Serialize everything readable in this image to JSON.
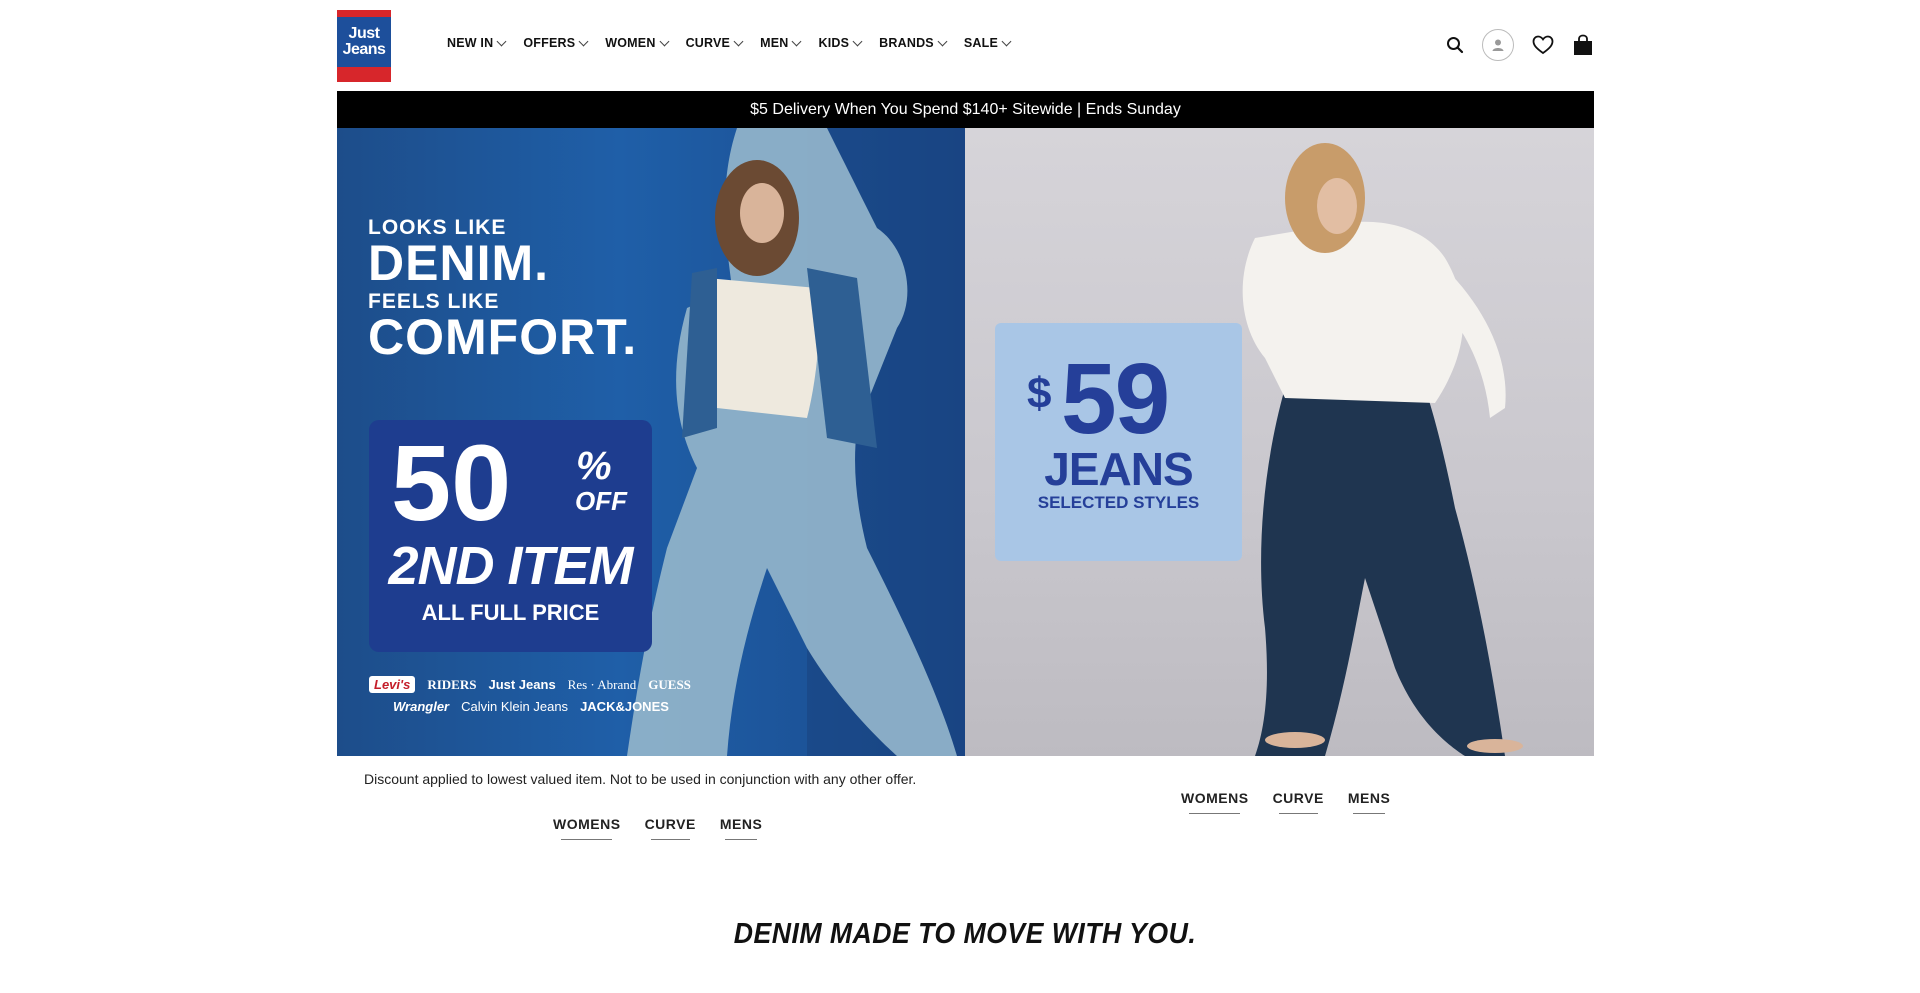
{
  "logo": {
    "line1": "Just",
    "line2": "Jeans",
    "colors": {
      "red": "#d7262b",
      "blue": "#1d4f9b"
    }
  },
  "nav": {
    "items": [
      {
        "label": "NEW IN"
      },
      {
        "label": "OFFERS"
      },
      {
        "label": "WOMEN"
      },
      {
        "label": "CURVE"
      },
      {
        "label": "MEN"
      },
      {
        "label": "KIDS"
      },
      {
        "label": "BRANDS"
      },
      {
        "label": "SALE"
      }
    ]
  },
  "header_icons": {
    "search": "search-icon",
    "account": "user-icon",
    "wishlist": "heart-icon",
    "cart": "shopping-bag-icon"
  },
  "promo_bar": {
    "text": "$5 Delivery When You Spend $140+ Sitewide | Ends Sunday"
  },
  "hero_left": {
    "line1_small": "LOOKS LIKE",
    "line1_big": "DENIM.",
    "line2_small": "FEELS LIKE",
    "line2_big": "COMFORT.",
    "offer_number": "50",
    "offer_percent": "%",
    "offer_off": "OFF",
    "offer_item": "2ND ITEM",
    "offer_full": "ALL FULL PRICE",
    "brands_row1": [
      "Levi's",
      "RIDERS",
      "Just Jeans",
      "Res · Abrand",
      "GUESS"
    ],
    "brands_row2": [
      "Wrangler",
      "Calvin Klein Jeans",
      "JACK&JONES"
    ],
    "disclaimer": "Discount applied to lowest valued item. Not to be used in conjunction with any other offer.",
    "links": [
      "WOMENS",
      "CURVE",
      "MENS"
    ]
  },
  "hero_right": {
    "dollar": "$",
    "price": "59",
    "label": "JEANS",
    "sub": "SELECTED STYLES",
    "links": [
      "WOMENS",
      "CURVE",
      "MENS"
    ]
  },
  "tagline": "DENIM MADE TO MOVE WITH YOU."
}
